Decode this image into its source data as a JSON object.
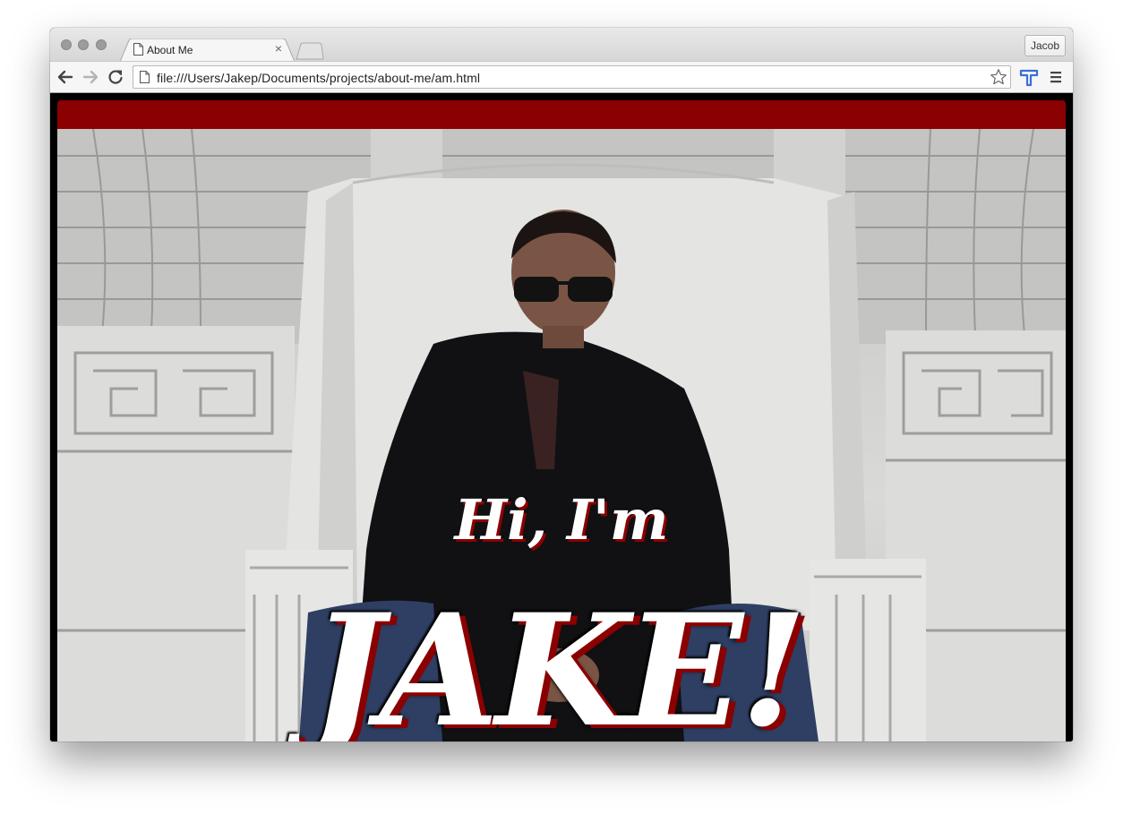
{
  "browser": {
    "tab_title": "About Me",
    "tab_close_glyph": "×",
    "profile_name": "Jacob",
    "address_url": "file:///Users/Jakep/Documents/projects/about-me/am.html",
    "icons": [
      "back-arrow-icon",
      "forward-arrow-icon",
      "reload-icon",
      "page-icon",
      "star-icon",
      "extension-icon",
      "menu-icon"
    ]
  },
  "page": {
    "header_bar_color": "#8b0000",
    "hero": {
      "greeting": "Hi, I'm",
      "name": "JAKE!",
      "text_color": "#ffffff",
      "shadow_color": "#8b0000"
    }
  }
}
